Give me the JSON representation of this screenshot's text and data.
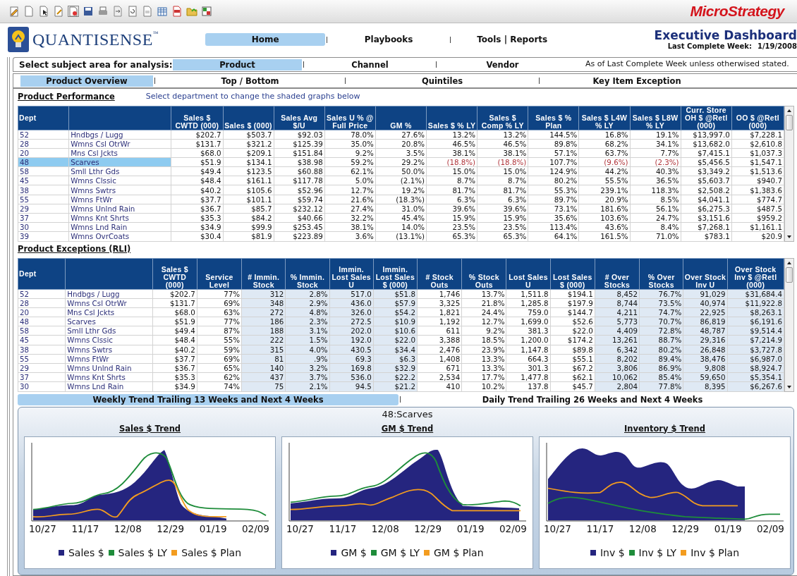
{
  "toolbar": {
    "brand": "MicroStrategy"
  },
  "header": {
    "logo_text": "QUANTISENSE",
    "logo_mark": "™",
    "title": "Executive Dashboard",
    "week_label": "Last Complete Week:",
    "week_value": "1/19/2008",
    "nav": [
      {
        "label": "Home",
        "selected": true
      },
      {
        "label": "Playbooks",
        "selected": false
      },
      {
        "label": "Tools | Reports",
        "selected": false
      }
    ]
  },
  "subject_area": {
    "label": "Select subject area for analysis:",
    "note": "As of Last Complete Week unless otherwised stated.",
    "options": [
      {
        "label": "Product",
        "selected": true
      },
      {
        "label": "Channel",
        "selected": false
      },
      {
        "label": "Vendor",
        "selected": false
      }
    ]
  },
  "subtabs": [
    {
      "label": "Product Overview",
      "selected": true
    },
    {
      "label": "Top / Bottom",
      "selected": false
    },
    {
      "label": "Quintiles",
      "selected": false
    },
    {
      "label": "Key Item Exception",
      "selected": false
    }
  ],
  "product_performance": {
    "title": "Product Performance",
    "hint": "Select department to change the shaded graphs below",
    "dept_header": "Dept",
    "columns": [
      {
        "label": "Sales $ CWTD (000)"
      },
      {
        "label": "Sales $ (000)"
      },
      {
        "label": "Sales Avg $/U"
      },
      {
        "label": "Sales U % @ Full Price"
      },
      {
        "label": "GM %"
      },
      {
        "label": "Sales $ % LY"
      },
      {
        "label": "Sales $ Comp % LY"
      },
      {
        "label": "Sales $ % Plan"
      },
      {
        "label": "Sales $ L4W % LY"
      },
      {
        "label": "Sales $ L8W % LY"
      },
      {
        "label": "Curr. Store OH $ @Retl (000)"
      },
      {
        "label": "OO $ @Retl (000)"
      }
    ],
    "rows": [
      {
        "dept": "52",
        "name": "Hndbgs / Lugg",
        "selected": false,
        "values": [
          "$202.7",
          "$503.7",
          "$92.03",
          "78.0%",
          "27.6%",
          "13.2%",
          "13.2%",
          "144.5%",
          "16.8%",
          "19.1%",
          "$13,997.0",
          "$7,228.1"
        ]
      },
      {
        "dept": "28",
        "name": "Wmns Csl OtrWr",
        "selected": false,
        "values": [
          "$131.7",
          "$321.2",
          "$125.39",
          "35.0%",
          "20.8%",
          "46.5%",
          "46.5%",
          "89.8%",
          "68.2%",
          "34.1%",
          "$13,682.0",
          "$2,610.8"
        ]
      },
      {
        "dept": "20",
        "name": "Mns Csl Jckts",
        "selected": false,
        "values": [
          "$68.0",
          "$209.1",
          "$151.84",
          "9.2%",
          "3.5%",
          "38.1%",
          "38.1%",
          "57.1%",
          "63.7%",
          "7.7%",
          "$7,415.1",
          "$1,037.3"
        ]
      },
      {
        "dept": "48",
        "name": "Scarves",
        "selected": true,
        "values": [
          "$51.9",
          "$134.1",
          "$38.98",
          "59.2%",
          "29.2%",
          {
            "text": "(18.8%)",
            "alert": true
          },
          {
            "text": "(18.8%)",
            "alert": true
          },
          "107.7%",
          {
            "text": "(9.6%)",
            "alert": true
          },
          {
            "text": "(2.3%)",
            "alert": true
          },
          "$5,456.5",
          "$1,547.1"
        ]
      },
      {
        "dept": "58",
        "name": "Smll Lthr Gds",
        "selected": false,
        "values": [
          "$49.4",
          "$123.5",
          "$60.88",
          "62.1%",
          "50.0%",
          "15.0%",
          "15.0%",
          "124.9%",
          "44.2%",
          "40.3%",
          "$3,349.2",
          "$1,513.6"
        ]
      },
      {
        "dept": "45",
        "name": "Wmns Clssic",
        "selected": false,
        "values": [
          "$48.4",
          "$161.1",
          "$117.78",
          "5.0%",
          "(2.1%)",
          "8.7%",
          "8.7%",
          "80.2%",
          "55.5%",
          "36.5%",
          "$5,603.7",
          "$940.7"
        ]
      },
      {
        "dept": "38",
        "name": "Wmns Swtrs",
        "selected": false,
        "values": [
          "$40.2",
          "$105.6",
          "$52.96",
          "12.7%",
          "19.2%",
          "81.7%",
          "81.7%",
          "55.3%",
          "239.1%",
          "118.3%",
          "$2,508.2",
          "$1,383.6"
        ]
      },
      {
        "dept": "55",
        "name": "Wmns FtWr",
        "selected": false,
        "values": [
          "$37.7",
          "$101.1",
          "$59.74",
          "21.6%",
          "(18.3%)",
          "6.3%",
          "6.3%",
          "89.7%",
          "20.9%",
          "8.5%",
          "$4,041.1",
          "$774.7"
        ]
      },
      {
        "dept": "29",
        "name": "Wmns Unlnd Rain",
        "selected": false,
        "values": [
          "$36.7",
          "$85.7",
          "$232.12",
          "27.4%",
          "31.0%",
          "39.6%",
          "39.6%",
          "73.1%",
          "181.6%",
          "56.1%",
          "$6,275.3",
          "$487.5"
        ]
      },
      {
        "dept": "37",
        "name": "Wmns Knt Shrts",
        "selected": false,
        "values": [
          "$35.3",
          "$84.2",
          "$40.66",
          "32.2%",
          "45.4%",
          "15.9%",
          "15.9%",
          "35.6%",
          "103.6%",
          "24.7%",
          "$3,151.6",
          "$959.2"
        ]
      },
      {
        "dept": "30",
        "name": "Wmns Lnd Rain",
        "selected": false,
        "values": [
          "$34.9",
          "$99.9",
          "$253.45",
          "38.1%",
          "14.0%",
          "23.5%",
          "23.5%",
          "113.4%",
          "43.6%",
          "8.4%",
          "$7,268.1",
          "$1,161.1"
        ]
      },
      {
        "dept": "39",
        "name": "Wmns OvrCoats",
        "selected": false,
        "values": [
          "$30.4",
          "$81.9",
          "$223.89",
          "3.6%",
          "(13.1%)",
          "65.3%",
          "65.3%",
          "64.1%",
          "161.5%",
          "71.0%",
          "$783.1",
          "$20.9"
        ]
      }
    ]
  },
  "product_exceptions": {
    "title": "Product Exceptions (RLI)",
    "dept_header": "Dept",
    "columns": [
      {
        "label": "Sales $ CWTD (000)",
        "shaded": false
      },
      {
        "label": "Service Level",
        "shaded": false
      },
      {
        "label": "# Immin. Stock",
        "shaded": true
      },
      {
        "label": "% Immin. Stock",
        "shaded": true
      },
      {
        "label": "Immin. Lost Sales U",
        "shaded": true
      },
      {
        "label": "Immin. Lost Sales $ (000)",
        "shaded": true
      },
      {
        "label": "# Stock Outs",
        "shaded": false
      },
      {
        "label": "% Stock Outs",
        "shaded": false
      },
      {
        "label": "Lost Sales U",
        "shaded": false
      },
      {
        "label": "Lost Sales $ (000)",
        "shaded": false
      },
      {
        "label": "# Over Stocks",
        "shaded": true
      },
      {
        "label": "% Over Stocks",
        "shaded": true
      },
      {
        "label": "Over Stock Inv U",
        "shaded": true
      },
      {
        "label": "Over Stock Inv $ @Retl (000)",
        "shaded": true
      }
    ],
    "rows": [
      {
        "dept": "52",
        "name": "Hndbgs / Lugg",
        "values": [
          "$202.7",
          "77%",
          "312",
          "2.8%",
          "517.0",
          "$51.8",
          "1,746",
          "13.7%",
          "1,511.8",
          "$194.1",
          "8,452",
          "76.7%",
          "91,029",
          "$31,684.4"
        ]
      },
      {
        "dept": "28",
        "name": "Wmns Csl OtrWr",
        "values": [
          "$131.7",
          "69%",
          "348",
          "2.9%",
          "436.0",
          "$57.9",
          "3,325",
          "21.8%",
          "1,285.8",
          "$197.9",
          "8,744",
          "73.5%",
          "40,974",
          "$11,922.8"
        ]
      },
      {
        "dept": "20",
        "name": "Mns Csl Jckts",
        "values": [
          "$68.0",
          "63%",
          "272",
          "4.8%",
          "326.0",
          "$54.2",
          "1,821",
          "24.4%",
          "759.0",
          "$144.7",
          "4,211",
          "74.7%",
          "22,925",
          "$8,263.1"
        ]
      },
      {
        "dept": "48",
        "name": "Scarves",
        "values": [
          "$51.9",
          "77%",
          "186",
          "2.3%",
          "272.5",
          "$10.9",
          "1,192",
          "12.7%",
          "1,699.0",
          "$52.6",
          "5,773",
          "70.7%",
          "86,819",
          "$6,191.6"
        ]
      },
      {
        "dept": "58",
        "name": "Smll Lthr Gds",
        "values": [
          "$49.4",
          "87%",
          "188",
          "3.1%",
          "202.0",
          "$10.6",
          "611",
          "9.2%",
          "381.3",
          "$22.0",
          "4,409",
          "72.8%",
          "48,787",
          "$9,514.4"
        ]
      },
      {
        "dept": "45",
        "name": "Wmns Clssic",
        "values": [
          "$48.4",
          "55%",
          "222",
          "1.5%",
          "192.0",
          "$22.0",
          "3,388",
          "18.5%",
          "1,200.0",
          "$174.2",
          "13,261",
          "88.7%",
          "29,316",
          "$7,214.9"
        ]
      },
      {
        "dept": "38",
        "name": "Wmns Swtrs",
        "values": [
          "$40.2",
          "59%",
          "315",
          "4.0%",
          "430.5",
          "$34.4",
          "2,476",
          "23.9%",
          "1,147.8",
          "$89.8",
          "6,342",
          "80.2%",
          "26,848",
          "$3,727.8"
        ]
      },
      {
        "dept": "55",
        "name": "Wmns FtWr",
        "values": [
          "$37.7",
          "69%",
          "81",
          ".9%",
          "69.3",
          "$6.3",
          "1,408",
          "13.3%",
          "664.3",
          "$55.1",
          "8,202",
          "89.4%",
          "38,476",
          "$6,987.0"
        ]
      },
      {
        "dept": "29",
        "name": "Wmns Unlnd Rain",
        "values": [
          "$36.7",
          "65%",
          "140",
          "3.2%",
          "169.8",
          "$32.9",
          "671",
          "13.3%",
          "301.3",
          "$67.2",
          "3,806",
          "86.9%",
          "9,808",
          "$8,924.7"
        ]
      },
      {
        "dept": "37",
        "name": "Wmns Knt Shrts",
        "values": [
          "$35.3",
          "62%",
          "437",
          "3.7%",
          "536.0",
          "$22.2",
          "2,534",
          "17.7%",
          "1,477.8",
          "$62.1",
          "10,062",
          "85.4%",
          "59,650",
          "$5,354.1"
        ]
      },
      {
        "dept": "30",
        "name": "Wmns Lnd Rain",
        "values": [
          "$34.9",
          "74%",
          "75",
          "2.1%",
          "94.5",
          "$21.2",
          "410",
          "10.2%",
          "137.8",
          "$45.7",
          "2,804",
          "77.8%",
          "8,395",
          "$6,267.6"
        ]
      }
    ]
  },
  "trend_tabs": [
    {
      "label": "Weekly Trend Trailing 13 Weeks and Next 4 Weeks",
      "selected": true
    },
    {
      "label": "Daily Trend Trailing 26 Weeks and Next 4 Weeks",
      "selected": false
    }
  ],
  "trend_panel": {
    "title": "48:Scarves",
    "charts": [
      {
        "title": "Sales $ Trend",
        "x_labels": [
          "10/27",
          "11/17",
          "12/08",
          "12/29",
          "01/19",
          "02/09"
        ],
        "legend": [
          {
            "label": "Sales $",
            "color": "#25257f"
          },
          {
            "label": "Sales $ LY",
            "color": "#1e8c3a"
          },
          {
            "label": "Sales $ Plan",
            "color": "#f39c1f"
          }
        ]
      },
      {
        "title": "GM $ Trend",
        "x_labels": [
          "10/27",
          "11/17",
          "12/08",
          "12/29",
          "01/19",
          "02/09"
        ],
        "legend": [
          {
            "label": "GM $",
            "color": "#25257f"
          },
          {
            "label": "GM $ LY",
            "color": "#1e8c3a"
          },
          {
            "label": "GM $ Plan",
            "color": "#f39c1f"
          }
        ]
      },
      {
        "title": "Inventory $ Trend",
        "x_labels": [
          "10/27",
          "11/17",
          "12/08",
          "12/29",
          "01/19",
          "02/09"
        ],
        "legend": [
          {
            "label": "Inv $",
            "color": "#25257f"
          },
          {
            "label": "Inv $ LY",
            "color": "#1e8c3a"
          },
          {
            "label": "Inv $ Plan",
            "color": "#f39c1f"
          }
        ]
      }
    ]
  }
}
